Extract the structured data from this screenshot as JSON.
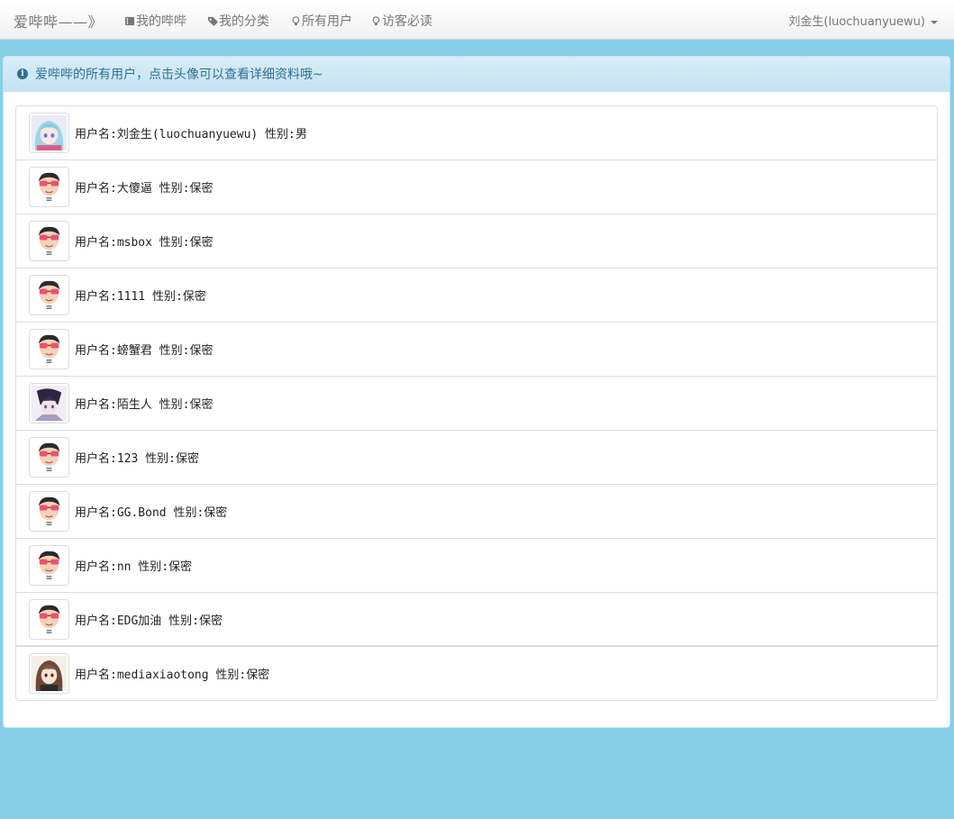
{
  "navbar": {
    "brand": "爱哔哔——》",
    "items": [
      {
        "label": "我的哔哔",
        "icon": "book-icon"
      },
      {
        "label": "我的分类",
        "icon": "tag-icon"
      },
      {
        "label": "所有用户",
        "icon": "lightbulb-icon"
      },
      {
        "label": "访客必读",
        "icon": "lightbulb-icon"
      }
    ],
    "user": "刘金生(luochuanyuewu)"
  },
  "panel": {
    "heading": "爱哔哔的所有用户，点击头像可以查看详细资料哦~"
  },
  "users": [
    {
      "text": "用户名:刘金生(luochuanyuewu) 性别:男",
      "avatar": "anime-blue"
    },
    {
      "text": "用户名:大傻逼 性别:保密",
      "avatar": "default"
    },
    {
      "text": "用户名:msbox 性别:保密",
      "avatar": "default"
    },
    {
      "text": "用户名:1111 性别:保密",
      "avatar": "default"
    },
    {
      "text": "用户名:螃蟹君 性别:保密",
      "avatar": "default"
    },
    {
      "text": "用户名:陌生人 性别:保密",
      "avatar": "anime-dark"
    },
    {
      "text": "用户名:123 性别:保密",
      "avatar": "default"
    },
    {
      "text": "用户名:GG.Bond 性别:保密",
      "avatar": "default"
    },
    {
      "text": "用户名:nn 性别:保密",
      "avatar": "default"
    },
    {
      "text": "用户名:EDG加油 性别:保密",
      "avatar": "default"
    },
    {
      "text": "用户名:mediaxiaotong 性别:保密",
      "avatar": "anime-brown"
    }
  ],
  "colors": {
    "background": "#87cee9",
    "heading_text": "#31708f",
    "heading_bg": "#d9edf7"
  }
}
